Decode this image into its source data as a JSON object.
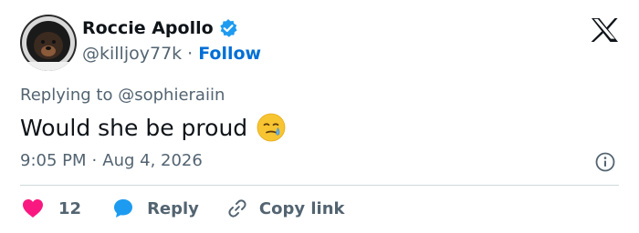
{
  "author": {
    "display_name": "Roccie Apollo",
    "handle": "@killjoy77k",
    "separator": "·",
    "follow_label": "Follow"
  },
  "tweet": {
    "replying_prefix": "Replying to",
    "replying_handle": "@sophieraiin",
    "text": "Would she be proud",
    "time": "9:05 PM",
    "date_separator": "·",
    "date": "Aug 4, 2026"
  },
  "actions": {
    "like_count": "12",
    "reply_label": "Reply",
    "copy_label": "Copy link"
  },
  "icons": {
    "verified": "verified-badge-icon",
    "x_logo": "x-logo-icon",
    "emoji": "face-holding-back-tears-emoji",
    "info": "info-icon",
    "like": "heart-icon",
    "reply": "speech-bubble-icon",
    "copy": "link-icon"
  },
  "colors": {
    "text_primary": "#0f1419",
    "text_secondary": "#536471",
    "link_blue": "#006fd6",
    "verified_blue": "#1d9bf0",
    "like_pink": "#f91880",
    "divider": "#cfd9de"
  }
}
